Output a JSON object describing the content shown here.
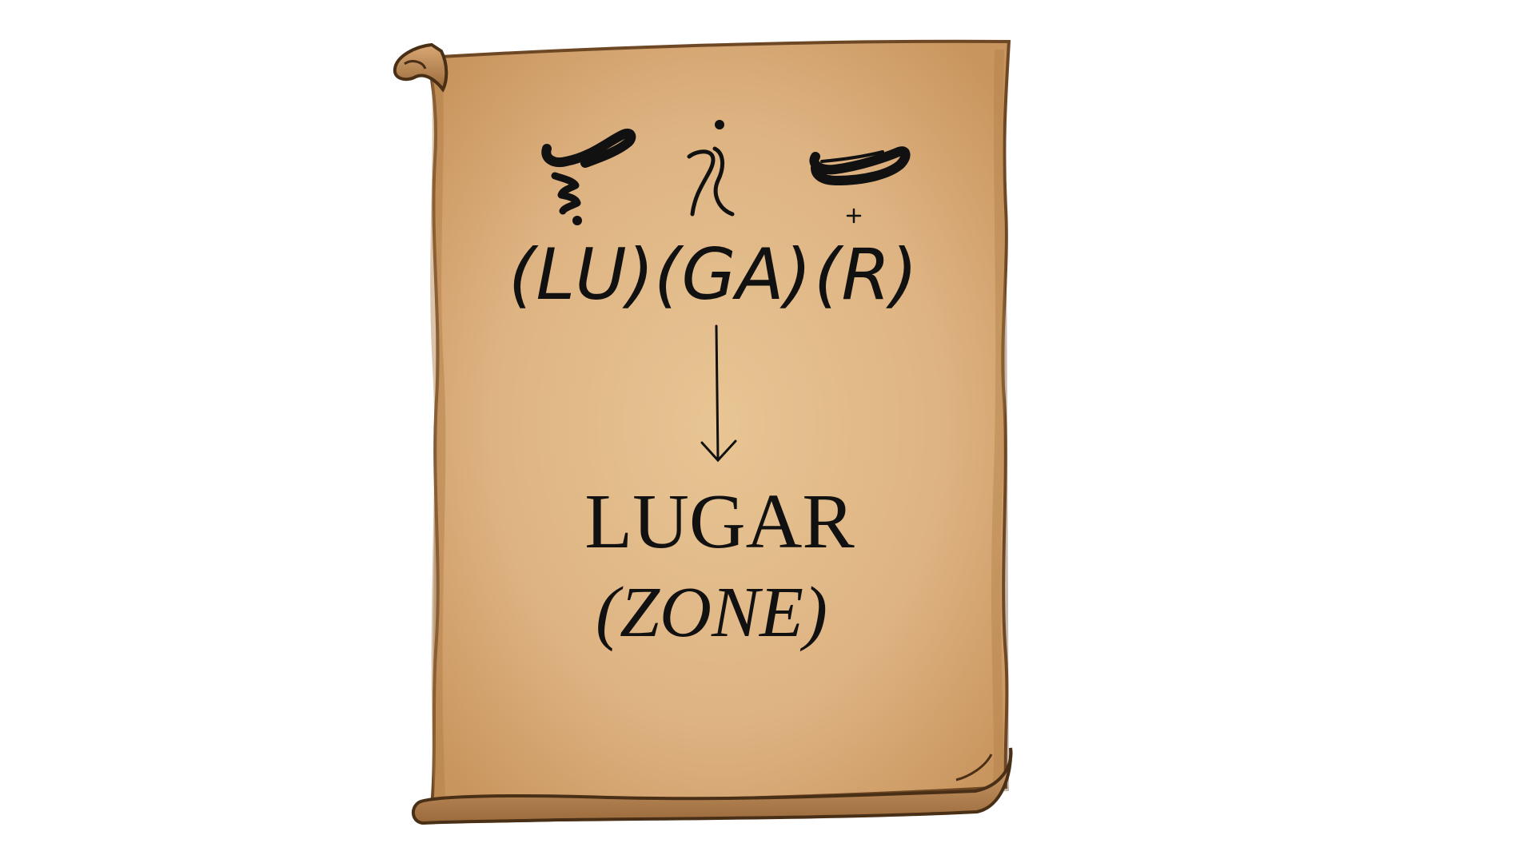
{
  "syllables": [
    {
      "label": "(LU)"
    },
    {
      "label": "(GA)"
    },
    {
      "label": "(R)"
    }
  ],
  "result": {
    "word": "LUGAR",
    "translation": "(ZONE)"
  },
  "icons": {
    "glyph_lu": "baybayin-lu-glyph-icon",
    "glyph_ga": "baybayin-ga-glyph-icon",
    "glyph_r": "baybayin-ra-virama-glyph-icon",
    "arrow": "arrow-down-icon"
  },
  "colors": {
    "parchment": "#e1b887",
    "parchment_edge": "#9a6a3c",
    "ink": "#111111",
    "background": "#ffffff"
  }
}
